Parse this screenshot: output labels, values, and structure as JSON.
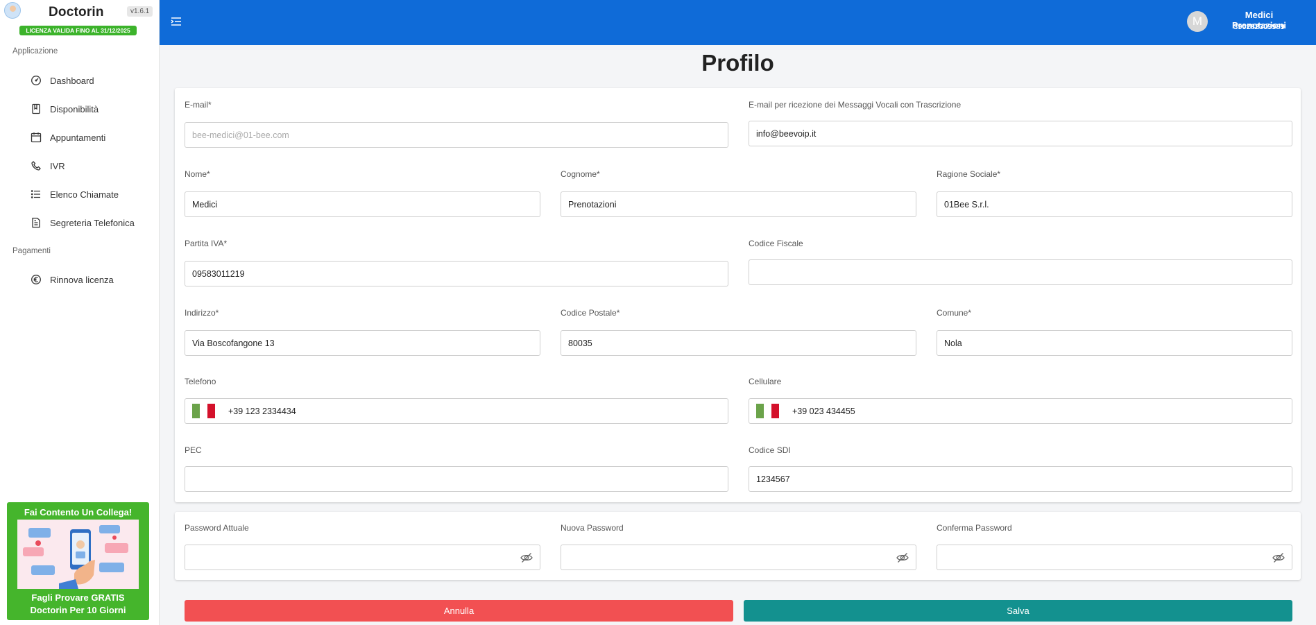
{
  "brand": {
    "name": "Doctorin",
    "version": "v1.6.1",
    "license": "LICENZA VALIDA FINO AL 31/12/2025"
  },
  "sidebar": {
    "section_app": "Applicazione",
    "items": [
      {
        "label": "Dashboard",
        "icon": "gauge-icon"
      },
      {
        "label": "Disponibilità",
        "icon": "book-icon"
      },
      {
        "label": "Appuntamenti",
        "icon": "calendar-icon"
      },
      {
        "label": "IVR",
        "icon": "phone-icon"
      },
      {
        "label": "Elenco Chiamate",
        "icon": "list-icon"
      },
      {
        "label": "Segreteria Telefonica",
        "icon": "document-icon"
      }
    ],
    "section_payments": "Pagamenti",
    "payment_items": [
      {
        "label": "Rinnova licenza",
        "icon": "euro-icon"
      }
    ]
  },
  "promo": {
    "title": "Fai Contento Un Collega!",
    "line1": "Fagli Provare GRATIS",
    "line2": "Doctorin Per 10 Giorni"
  },
  "topbar": {
    "user_initial": "M",
    "user_name": "Medici Prenotazioni",
    "user_phone": "390282309989"
  },
  "page": {
    "title": "Profilo"
  },
  "form": {
    "email": {
      "label": "E-mail*",
      "placeholder": "bee-medici@01-bee.com"
    },
    "email_voice": {
      "label": "E-mail per ricezione dei Messaggi Vocali con Trascrizione",
      "value": "info@beevoip.it"
    },
    "nome": {
      "label": "Nome*",
      "value": "Medici"
    },
    "cognome": {
      "label": "Cognome*",
      "value": "Prenotazioni"
    },
    "ragione": {
      "label": "Ragione Sociale*",
      "value": "01Bee S.r.l."
    },
    "piva": {
      "label": "Partita IVA*",
      "value": "09583011219"
    },
    "cf": {
      "label": "Codice Fiscale",
      "value": ""
    },
    "indirizzo": {
      "label": "Indirizzo*",
      "value": "Via Boscofangone 13"
    },
    "cap": {
      "label": "Codice Postale*",
      "value": "80035"
    },
    "comune": {
      "label": "Comune*",
      "value": "Nola"
    },
    "telefono": {
      "label": "Telefono",
      "value": "+39 123 2334434"
    },
    "cellulare": {
      "label": "Cellulare",
      "value": "+39 023 434455"
    },
    "pec": {
      "label": "PEC",
      "value": ""
    },
    "sdi": {
      "label": "Codice SDI",
      "value": "1234567"
    }
  },
  "passwords": {
    "current": {
      "label": "Password Attuale"
    },
    "new": {
      "label": "Nuova Password"
    },
    "confirm": {
      "label": "Conferma Password"
    }
  },
  "actions": {
    "cancel": "Annulla",
    "save": "Salva"
  },
  "colors": {
    "primary": "#0f6bd8",
    "success": "#45b52c",
    "cancel": "#f25052",
    "save": "#13918f"
  }
}
